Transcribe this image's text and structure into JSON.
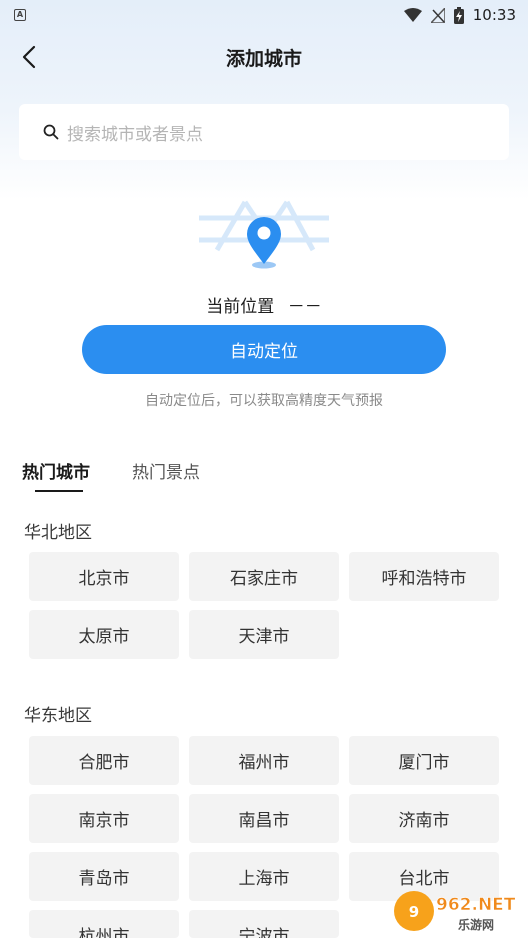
{
  "status_bar": {
    "app_indicator": "A",
    "time": "10:33"
  },
  "nav": {
    "title": "添加城市"
  },
  "search": {
    "placeholder": "搜索城市或者景点"
  },
  "location": {
    "current_label": "当前位置",
    "current_value": "－－",
    "auto_button": "自动定位",
    "hint": "自动定位后，可以获取高精度天气预报"
  },
  "tabs": [
    {
      "label": "热门城市",
      "active": true
    },
    {
      "label": "热门景点",
      "active": false
    }
  ],
  "regions": [
    {
      "title": "华北地区",
      "cities": [
        "北京市",
        "石家庄市",
        "呼和浩特市",
        "太原市",
        "天津市"
      ]
    },
    {
      "title": "华东地区",
      "cities": [
        "合肥市",
        "福州市",
        "厦门市",
        "南京市",
        "南昌市",
        "济南市",
        "青岛市",
        "上海市",
        "台北市",
        "杭州市",
        "宁波市"
      ]
    }
  ],
  "watermark": {
    "brand": "962.NET",
    "sub": "乐游网"
  },
  "colors": {
    "accent": "#2b8ef0",
    "city_button_bg": "#f3f3f3",
    "header_bg": "#e4eef9"
  }
}
